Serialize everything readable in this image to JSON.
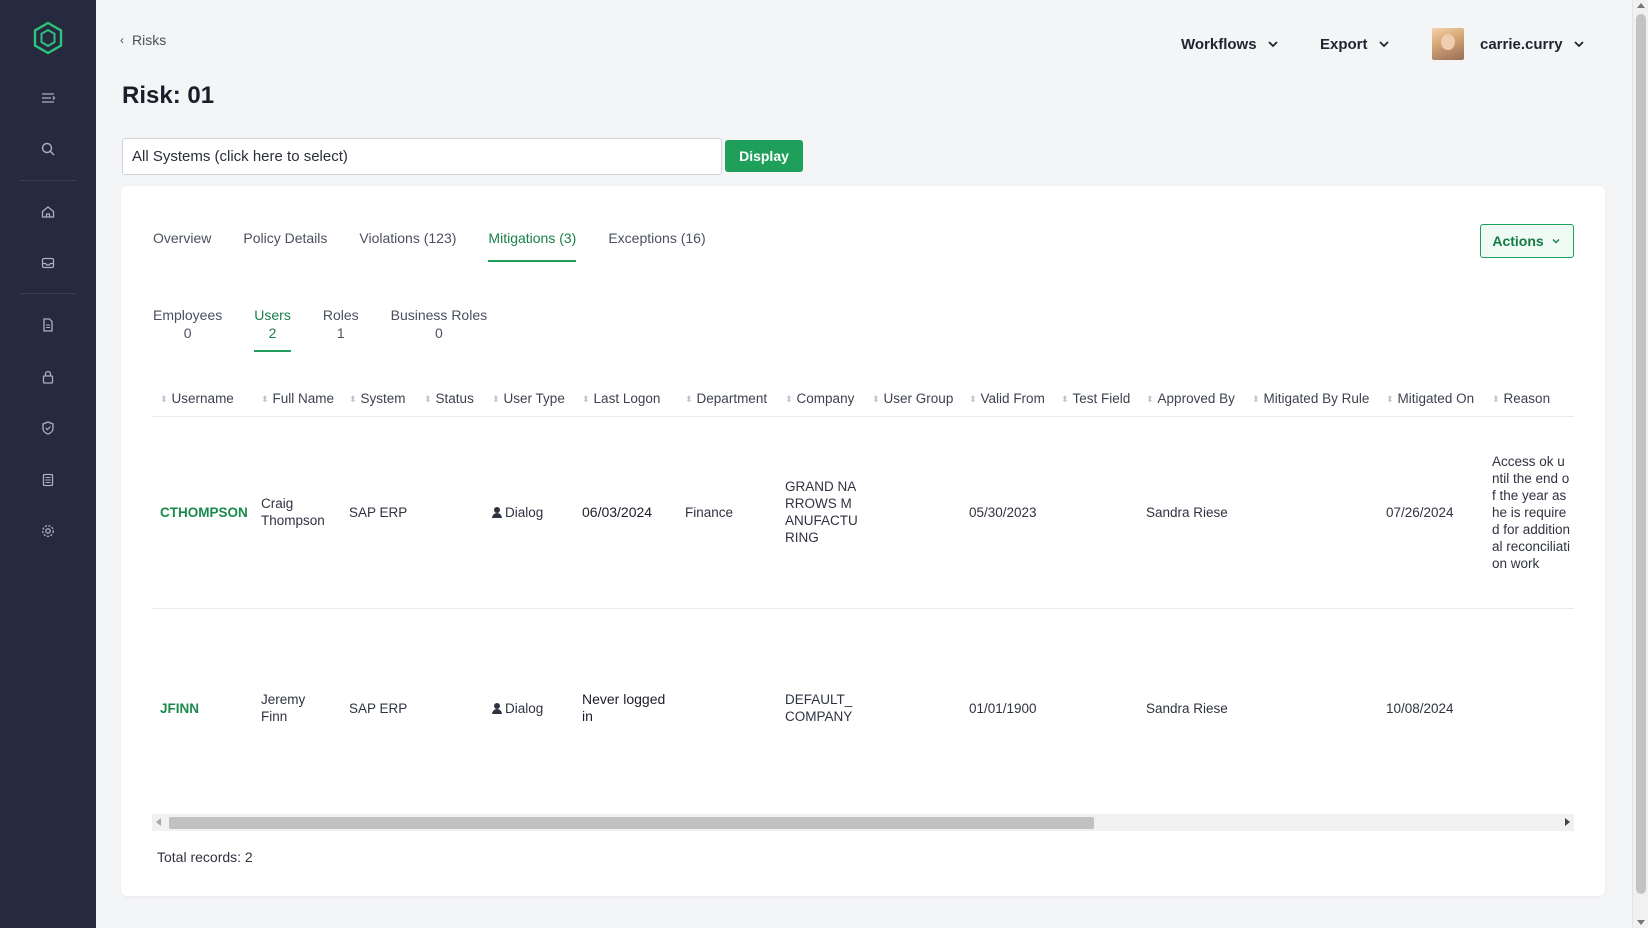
{
  "breadcrumb": {
    "back_label": "Risks"
  },
  "page": {
    "title": "Risk: 01"
  },
  "topnav": {
    "workflows": "Workflows",
    "export": "Export",
    "user": "carrie.curry"
  },
  "systems": {
    "value": "All Systems (click here to select)",
    "display_button": "Display"
  },
  "tabs": [
    {
      "label": "Overview"
    },
    {
      "label": "Policy Details"
    },
    {
      "label": "Violations (123)"
    },
    {
      "label": "Mitigations (3)"
    },
    {
      "label": "Exceptions (16)"
    }
  ],
  "active_tab": "Mitigations (3)",
  "actions_button": "Actions",
  "subtabs": [
    {
      "label": "Employees",
      "count": "0"
    },
    {
      "label": "Users",
      "count": "2"
    },
    {
      "label": "Roles",
      "count": "1"
    },
    {
      "label": "Business Roles",
      "count": "0"
    }
  ],
  "table": {
    "columns": [
      "Username",
      "Full Name",
      "System",
      "Status",
      "User Type",
      "Last Logon",
      "Department",
      "Company",
      "User Group",
      "Valid From",
      "Test Field",
      "Approved By",
      "Mitigated By Rule",
      "Mitigated On",
      "Reason"
    ],
    "rows": [
      {
        "username": "CTHOMPSON",
        "full_name": "Craig Thompson",
        "system": "SAP ERP",
        "status": "",
        "user_type": "Dialog",
        "last_logon": "06/03/2024",
        "department": "Finance",
        "company": "GRAND NARROWS MANUFACTURING",
        "user_group": "",
        "valid_from": "05/30/2023",
        "test_field": "",
        "approved_by": "Sandra Riese",
        "mitigated_by_rule": "",
        "mitigated_on": "07/26/2024",
        "reason": "Access ok until the end of the year as he is required for additional reconciliation work"
      },
      {
        "username": "JFINN",
        "full_name": "Jeremy Finn",
        "system": "SAP ERP",
        "status": "",
        "user_type": "Dialog",
        "last_logon": "Never logged in",
        "department": "",
        "company": "DEFAULT_COMPANY",
        "user_group": "",
        "valid_from": "01/01/1900",
        "test_field": "",
        "approved_by": "Sandra Riese",
        "mitigated_by_rule": "",
        "mitigated_on": "10/08/2024",
        "reason": ""
      }
    ]
  },
  "footer": {
    "total_records": "Total records: 2"
  },
  "colors": {
    "accent": "#1ea05a",
    "sidebar": "#262a3e",
    "link": "#1a8a4c"
  },
  "icons": {
    "sidebar": [
      "logo-icon",
      "menu-collapse-icon",
      "search-icon",
      "home-icon",
      "inbox-icon",
      "document-icon",
      "lock-icon",
      "shield-icon",
      "report-icon",
      "settings-icon"
    ]
  }
}
